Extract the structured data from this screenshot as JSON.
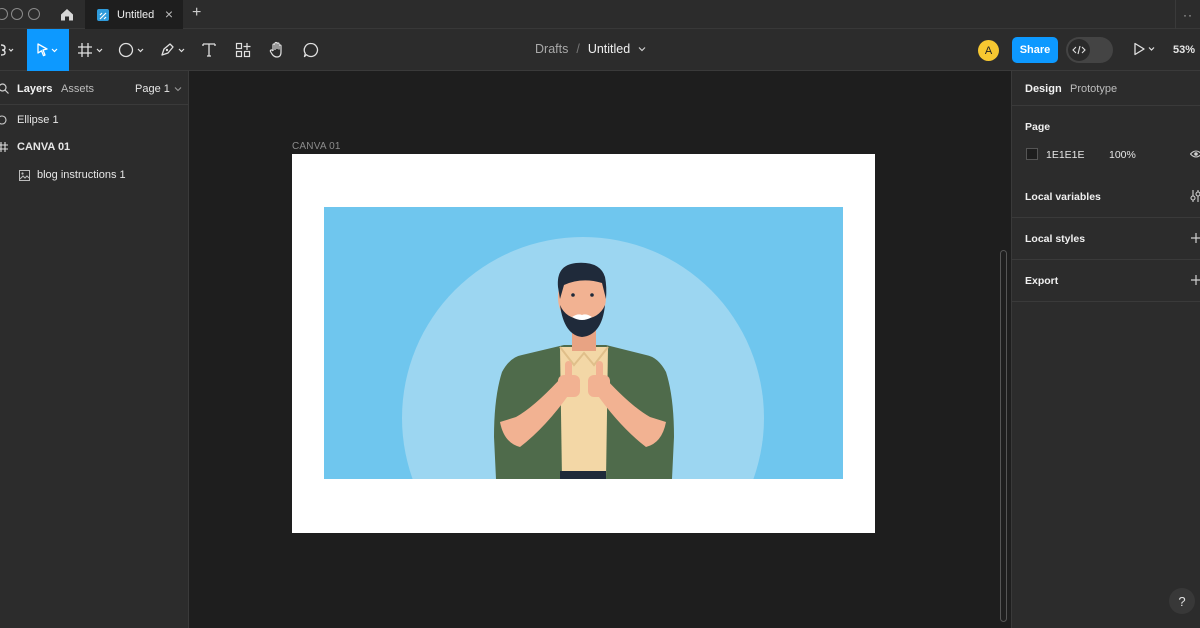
{
  "tabs": {
    "file_tab_title": "Untitled",
    "close_glyph": "×",
    "new_tab_glyph": "+",
    "more_glyph": "··"
  },
  "toolbar": {
    "breadcrumb_root": "Drafts",
    "breadcrumb_sep": "/",
    "file_title": "Untitled",
    "avatar_initial": "A",
    "share_label": "Share",
    "zoom_level": "53%",
    "tools": [
      "main-menu-icon",
      "move-icon",
      "frame-icon",
      "ellipse-icon",
      "pen-icon",
      "text-icon",
      "components-icon",
      "hand-icon",
      "comment-icon"
    ],
    "accent_color": "#0d99ff"
  },
  "left_panel": {
    "tab_layers": "Layers",
    "tab_assets": "Assets",
    "page_selector": "Page 1",
    "layers": [
      {
        "name": "Ellipse 1",
        "icon": "ellipse-layer-icon"
      },
      {
        "name": "CANVA 01",
        "icon": "frame-layer-icon"
      },
      {
        "name": "blog instructions 1",
        "icon": "image-layer-icon"
      }
    ]
  },
  "canvas": {
    "frame_label": "CANVA 01",
    "frame_color": "#ffffff",
    "image_bg_color": "#6fc6ee"
  },
  "right_panel": {
    "tab_design": "Design",
    "tab_prototype": "Prototype",
    "page_section_title": "Page",
    "page_color_hex": "1E1E1E",
    "page_opacity": "100%",
    "local_variables": "Local variables",
    "local_styles": "Local styles",
    "export": "Export",
    "help_glyph": "?"
  }
}
